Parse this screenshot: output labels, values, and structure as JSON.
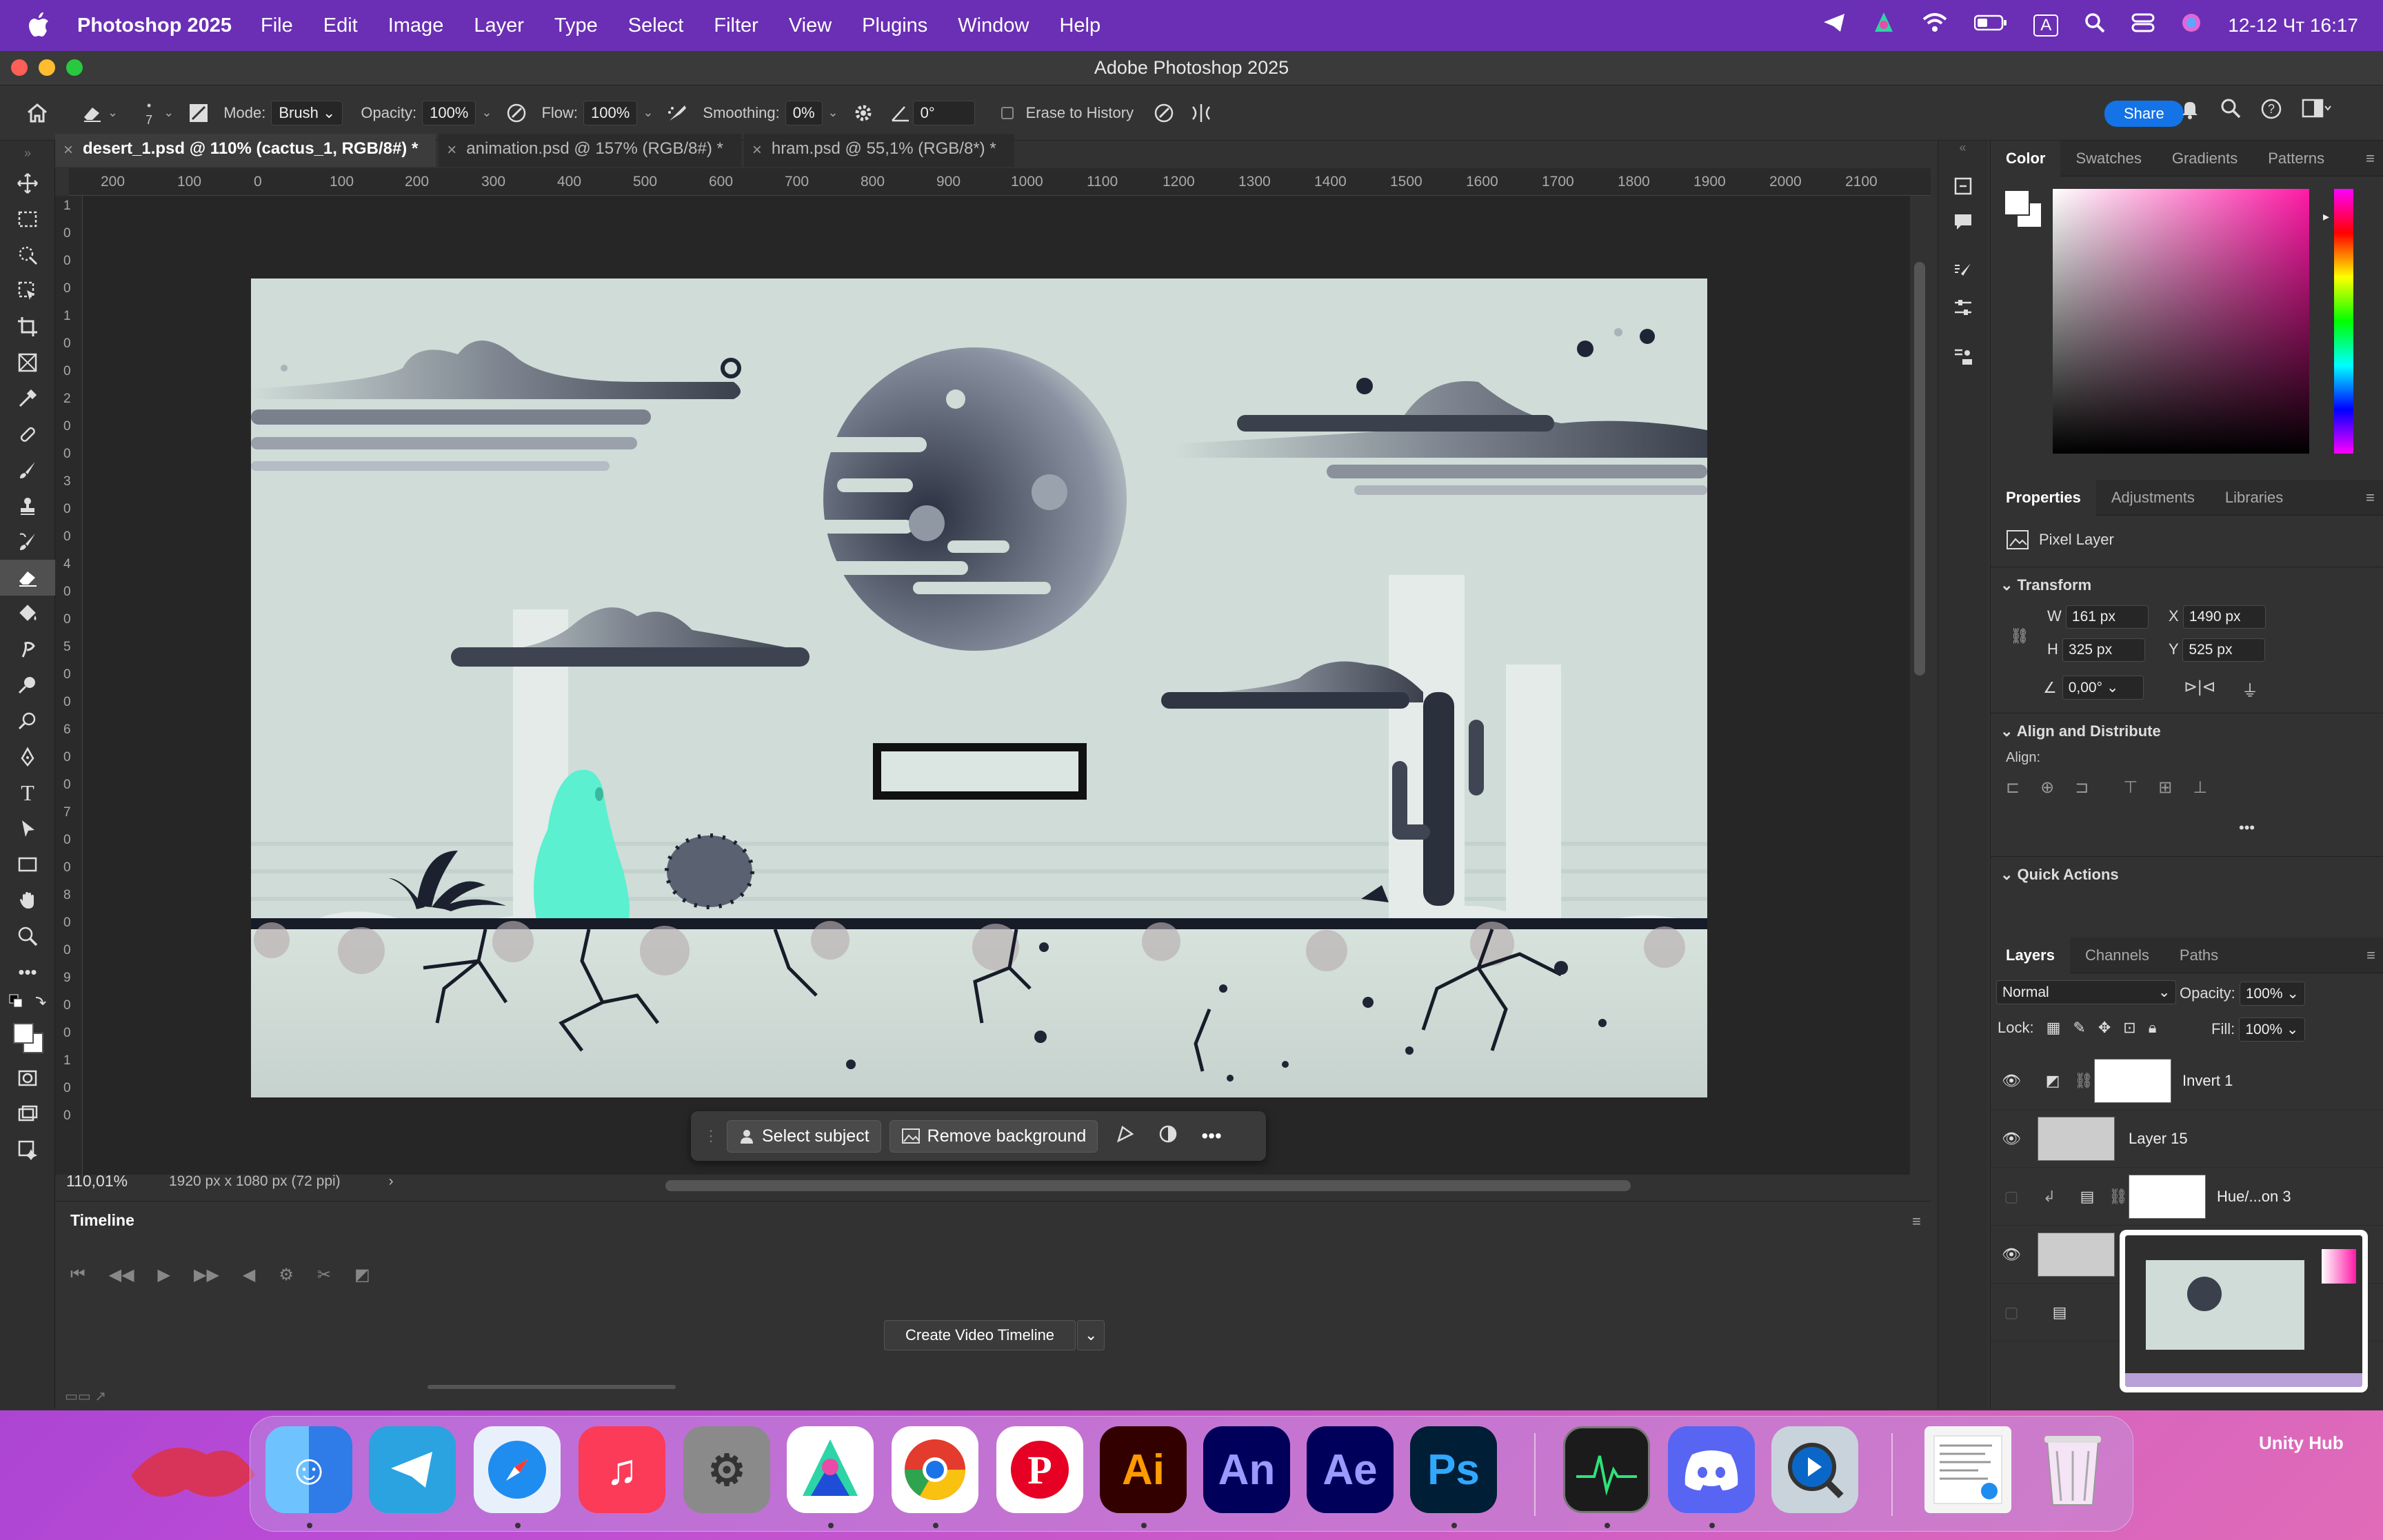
{
  "menubar": {
    "app_name": "Photoshop 2025",
    "items": [
      "File",
      "Edit",
      "Image",
      "Layer",
      "Type",
      "Select",
      "Filter",
      "View",
      "Plugins",
      "Window",
      "Help"
    ],
    "input_badge": "A",
    "clock": "12-12 Чт  16:17"
  },
  "window": {
    "title": "Adobe Photoshop 2025"
  },
  "options_bar": {
    "brush_size": "7",
    "mode_label": "Mode:",
    "mode_value": "Brush",
    "opacity_label": "Opacity:",
    "opacity_value": "100%",
    "flow_label": "Flow:",
    "flow_value": "100%",
    "smoothing_label": "Smoothing:",
    "smoothing_value": "0%",
    "angle_value": "0°",
    "erase_history_label": "Erase to History",
    "share_label": "Share"
  },
  "doc_tabs": [
    {
      "label": "desert_1.psd @ 110% (cactus_1, RGB/8#) *",
      "active": true
    },
    {
      "label": "animation.psd @ 157% (RGB/8#) *",
      "active": false
    },
    {
      "label": "hram.psd @ 55,1% (RGB/8*) *",
      "active": false
    }
  ],
  "ruler_h": [
    "200",
    "100",
    "0",
    "100",
    "200",
    "300",
    "400",
    "500",
    "600",
    "700",
    "800",
    "900",
    "1000",
    "1100",
    "1200",
    "1300",
    "1400",
    "1500",
    "1600",
    "1700",
    "1800",
    "1900",
    "2000",
    "2100"
  ],
  "ruler_v": [
    "1",
    "0",
    "0",
    "0",
    "1",
    "0",
    "0",
    "2",
    "0",
    "0",
    "3",
    "0",
    "0",
    "4",
    "0",
    "0",
    "5",
    "0",
    "0",
    "6",
    "0",
    "0",
    "7",
    "0",
    "0",
    "8",
    "0",
    "0",
    "9",
    "0",
    "0",
    "1",
    "0",
    "0"
  ],
  "context_bar": {
    "select_subject": "Select subject",
    "remove_background": "Remove background"
  },
  "status": {
    "zoom": "110,01%",
    "doc_info": "1920 px x 1080 px (72 ppi)"
  },
  "timeline": {
    "title": "Timeline",
    "create_label": "Create Video Timeline"
  },
  "color_panel": {
    "tabs": [
      "Color",
      "Swatches",
      "Gradients",
      "Patterns"
    ]
  },
  "properties_panel": {
    "tabs": [
      "Properties",
      "Adjustments",
      "Libraries"
    ],
    "layer_type": "Pixel Layer",
    "transform_title": "Transform",
    "w_label": "W",
    "w_value": "161 px",
    "x_label": "X",
    "x_value": "1490 px",
    "h_label": "H",
    "h_value": "325 px",
    "y_label": "Y",
    "y_value": "525 px",
    "angle_value": "0,00°",
    "align_title": "Align and Distribute",
    "align_label": "Align:",
    "quick_actions_title": "Quick Actions"
  },
  "layers_panel": {
    "tabs": [
      "Layers",
      "Channels",
      "Paths"
    ],
    "blend_mode": "Normal",
    "opacity_label": "Opacity:",
    "opacity_value": "100%",
    "lock_label": "Lock:",
    "fill_label": "Fill:",
    "fill_value": "100%",
    "layers": [
      {
        "name": "Invert 1",
        "visible": true
      },
      {
        "name": "Layer 15",
        "visible": true
      },
      {
        "name": "Hue/...on 3",
        "visible": false
      }
    ]
  },
  "dock": {
    "apps": [
      "Finder",
      "Telegram",
      "Safari",
      "Music",
      "System Settings",
      "Toolbox",
      "Chrome",
      "Pinterest",
      "Ai",
      "An",
      "Ae",
      "Ps",
      "Activity Monitor",
      "Discord",
      "QuickTime"
    ],
    "hover_label": "Unity Hub"
  },
  "colors": {
    "accent": "#1473e6",
    "selection": "#5af0d0",
    "canvas_bg": "#cfdcd7"
  }
}
